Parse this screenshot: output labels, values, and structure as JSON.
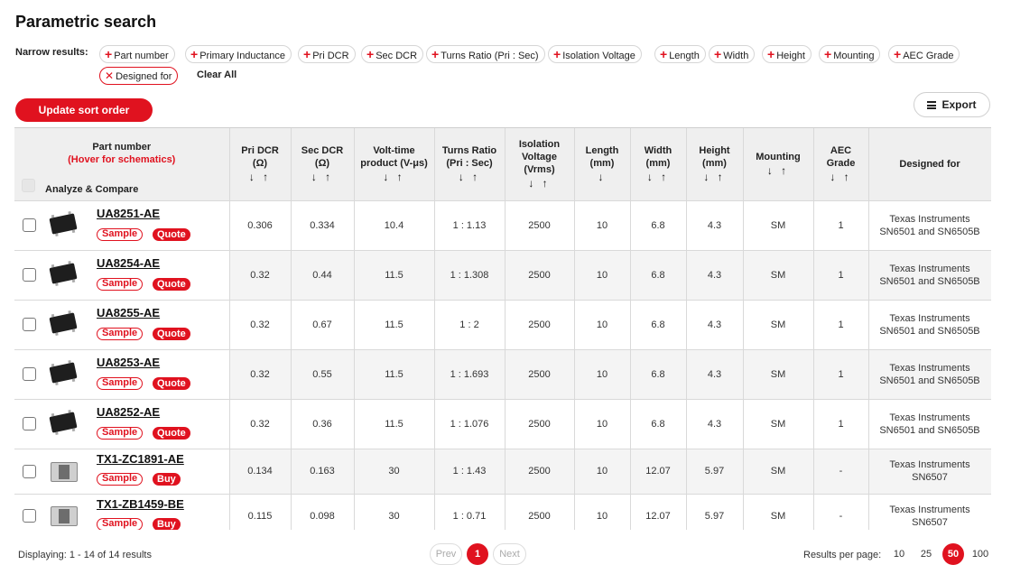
{
  "page": {
    "title": "Parametric search"
  },
  "filters": {
    "label": "Narrow results:",
    "chips": [
      "Part number",
      "Primary Inductance",
      "Pri DCR",
      "Sec DCR",
      "Turns Ratio (Pri : Sec)",
      "Isolation Voltage",
      "Length",
      "Width",
      "Height",
      "Mounting",
      "AEC Grade"
    ],
    "active_chip": "Designed for",
    "clear_all": "Clear All"
  },
  "toolbar": {
    "update_sort": "Update sort order",
    "export": "Export"
  },
  "table": {
    "part_header": "Part number",
    "part_hint": "(Hover for schematics)",
    "analyze": "Analyze & Compare",
    "sort_both": "↓ ↑",
    "sort_down": "↓",
    "columns": [
      {
        "label": "Pri DCR",
        "unit": "(Ω)"
      },
      {
        "label": "Sec DCR",
        "unit": "(Ω)"
      },
      {
        "label": "Volt-time product (V-μs)",
        "unit": ""
      },
      {
        "label": "Turns Ratio",
        "unit": "(Pri : Sec)"
      },
      {
        "label": "Isolation Voltage",
        "unit": "(Vrms)"
      },
      {
        "label": "Length",
        "unit": "(mm)"
      },
      {
        "label": "Width",
        "unit": "(mm)"
      },
      {
        "label": "Height",
        "unit": "(mm)"
      },
      {
        "label": "Mounting",
        "unit": ""
      },
      {
        "label": "AEC Grade",
        "unit": ""
      },
      {
        "label": "Designed for",
        "unit": ""
      }
    ],
    "rows": [
      {
        "part": "UA8251-AE",
        "image": "smd-chip-icon",
        "sample": "Sample",
        "action": "Quote",
        "values": [
          "0.306",
          "0.334",
          "10.4",
          "1 : 1.13",
          "2500",
          "10",
          "6.8",
          "4.3",
          "SM",
          "1",
          "Texas Instruments SN6501 and SN6505B"
        ]
      },
      {
        "part": "UA8254-AE",
        "image": "smd-chip-icon",
        "sample": "Sample",
        "action": "Quote",
        "values": [
          "0.32",
          "0.44",
          "11.5",
          "1 : 1.308",
          "2500",
          "10",
          "6.8",
          "4.3",
          "SM",
          "1",
          "Texas Instruments SN6501 and SN6505B"
        ]
      },
      {
        "part": "UA8255-AE",
        "image": "smd-chip-icon",
        "sample": "Sample",
        "action": "Quote",
        "values": [
          "0.32",
          "0.67",
          "11.5",
          "1 : 2",
          "2500",
          "10",
          "6.8",
          "4.3",
          "SM",
          "1",
          "Texas Instruments SN6501 and SN6505B"
        ]
      },
      {
        "part": "UA8253-AE",
        "image": "smd-chip-icon",
        "sample": "Sample",
        "action": "Quote",
        "values": [
          "0.32",
          "0.55",
          "11.5",
          "1 : 1.693",
          "2500",
          "10",
          "6.8",
          "4.3",
          "SM",
          "1",
          "Texas Instruments SN6501 and SN6505B"
        ]
      },
      {
        "part": "UA8252-AE",
        "image": "smd-chip-icon",
        "sample": "Sample",
        "action": "Quote",
        "values": [
          "0.32",
          "0.36",
          "11.5",
          "1 : 1.076",
          "2500",
          "10",
          "6.8",
          "4.3",
          "SM",
          "1",
          "Texas Instruments SN6501 and SN6505B"
        ]
      },
      {
        "part": "TX1-ZC1891-AE",
        "image": "transformer-icon",
        "sample": "Sample",
        "action": "Buy",
        "values": [
          "0.134",
          "0.163",
          "30",
          "1 : 1.43",
          "2500",
          "10",
          "12.07",
          "5.97",
          "SM",
          "-",
          "Texas Instruments SN6507"
        ]
      },
      {
        "part": "TX1-ZB1459-BE",
        "image": "transformer-icon",
        "sample": "Sample",
        "action": "Buy",
        "values": [
          "0.115",
          "0.098",
          "30",
          "1 : 0.71",
          "2500",
          "10",
          "12.07",
          "5.97",
          "SM",
          "-",
          "Texas Instruments SN6507"
        ]
      }
    ]
  },
  "footer": {
    "displaying": "Displaying: 1 - 14 of 14 results",
    "prev": "Prev",
    "current_page": "1",
    "next": "Next",
    "rpp_label": "Results per page:",
    "rpp_options": [
      "10",
      "25",
      "50",
      "100"
    ],
    "rpp_selected": "50"
  },
  "colors": {
    "accent": "#e0121f",
    "header_bg": "#efefef",
    "row_alt": "#f4f4f4"
  }
}
